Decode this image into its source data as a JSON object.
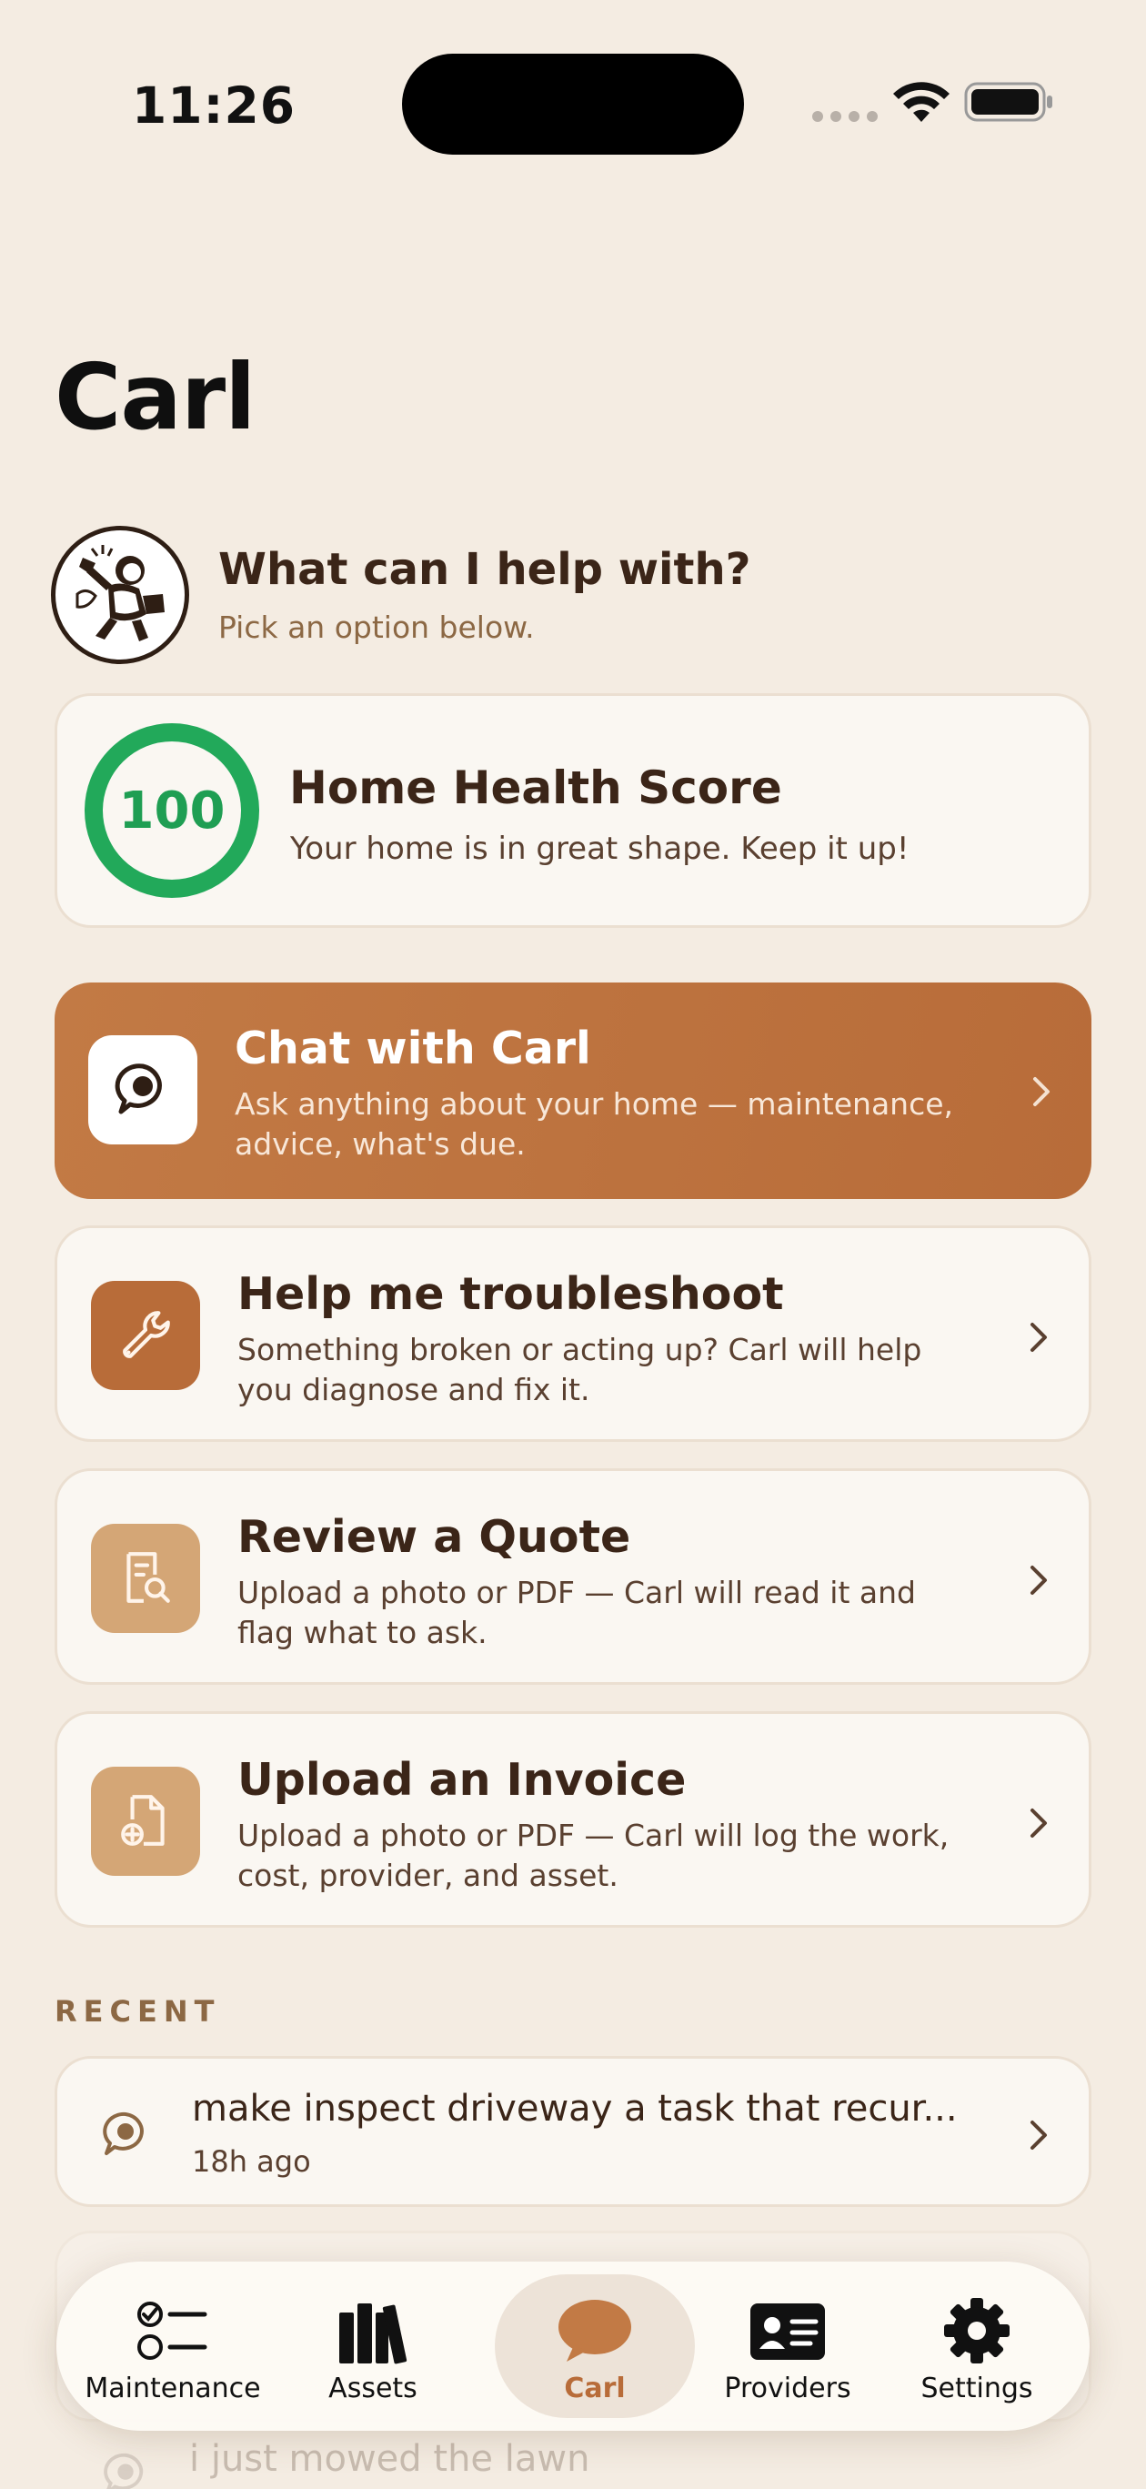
{
  "status_bar": {
    "time": "11:26"
  },
  "header": {
    "title": "Carl"
  },
  "intro": {
    "title": "What can I help with?",
    "subtitle": "Pick an option below."
  },
  "health": {
    "score": "100",
    "score_fraction": 1.0,
    "title": "Home Health Score",
    "description": "Your home is in great shape. Keep it up!",
    "accent_color": "#22A95A"
  },
  "options": [
    {
      "title": "Chat with Carl",
      "description": "Ask anything about your home — maintenance, advice, what's due.",
      "icon": "chat-bubble-icon"
    },
    {
      "title": "Help me troubleshoot",
      "description": "Something broken or acting up? Carl will help you diagnose and fix it.",
      "icon": "wrench-icon"
    },
    {
      "title": "Review a Quote",
      "description": "Upload a photo or PDF — Carl will read it and flag what to ask.",
      "icon": "document-search-icon"
    },
    {
      "title": "Upload an Invoice",
      "description": "Upload a photo or PDF — Carl will log the work, cost, provider, and asset.",
      "icon": "document-add-icon"
    }
  ],
  "recent": {
    "label": "RECENT",
    "items": [
      {
        "title": "make inspect driveway a task that recur...",
        "time": "18h ago"
      },
      {
        "title": "i just mowed the lawn",
        "time": ""
      }
    ]
  },
  "tabs": [
    {
      "label": "Maintenance",
      "icon": "checklist-icon"
    },
    {
      "label": "Assets",
      "icon": "books-icon"
    },
    {
      "label": "Carl",
      "icon": "chat-bubble-icon",
      "active": true
    },
    {
      "label": "Providers",
      "icon": "id-card-icon"
    },
    {
      "label": "Settings",
      "icon": "gear-icon"
    }
  ],
  "colors": {
    "brand": "#B86C39",
    "background": "#F4ECE2",
    "text": "#3B2518",
    "muted": "#8C6844"
  }
}
